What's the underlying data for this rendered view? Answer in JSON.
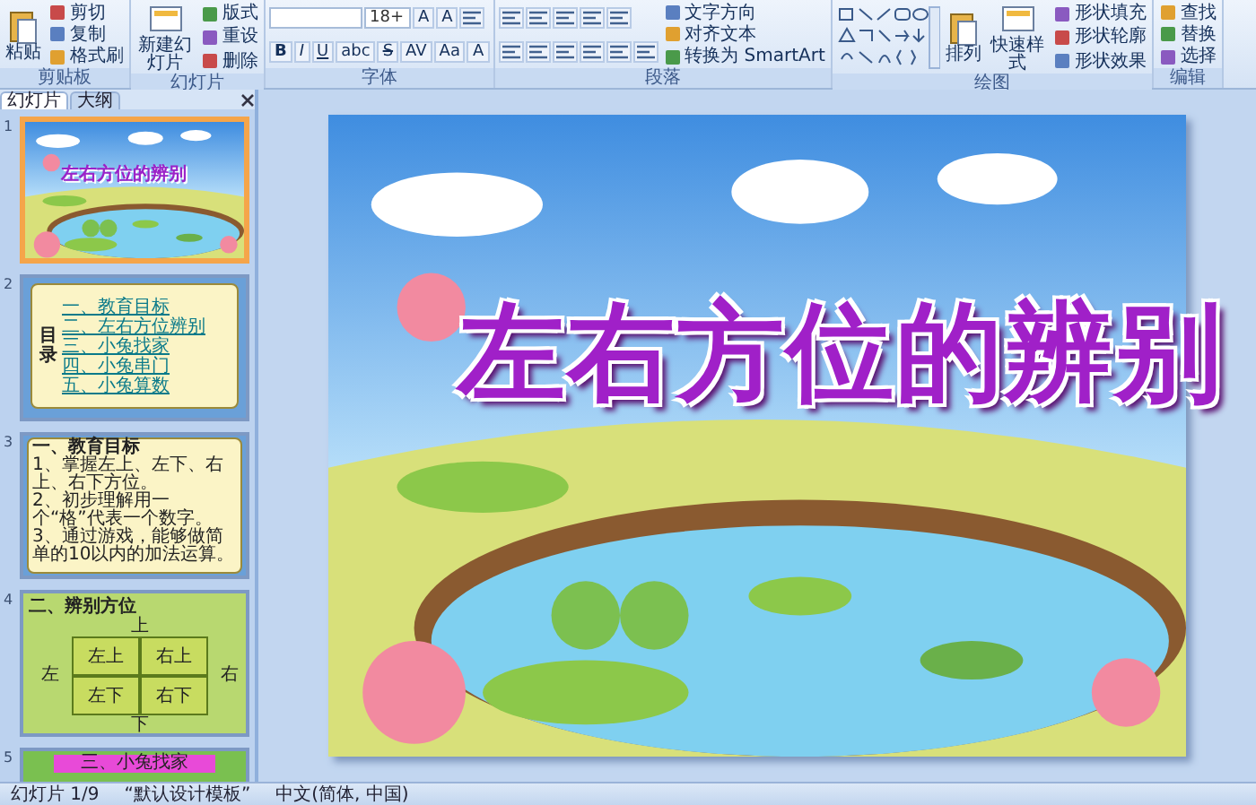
{
  "ribbon": {
    "groups": [
      {
        "label": "剪贴板",
        "columns": [
          {
            "items": [
              {
                "kind": "large",
                "label": "粘贴"
              }
            ]
          },
          {
            "items": [
              {
                "kind": "small",
                "label": "剪切"
              },
              {
                "kind": "small",
                "label": "复制"
              },
              {
                "kind": "small",
                "label": "格式刷"
              }
            ]
          }
        ]
      },
      {
        "label": "幻灯片",
        "columns": [
          {
            "items": [
              {
                "kind": "large",
                "label": "新建幻灯片"
              }
            ]
          },
          {
            "items": [
              {
                "kind": "small",
                "label": "版式"
              },
              {
                "kind": "small",
                "label": "重设"
              },
              {
                "kind": "small",
                "label": "删除"
              }
            ]
          }
        ]
      },
      {
        "label": "字体",
        "columns": [
          {
            "items": [
              {
                "kind": "strip",
                "items": [
                  {
                    "kind": "field",
                    "wide": true
                  },
                  {
                    "kind": "field",
                    "value": "18+"
                  },
                  {
                    "kind": "glyph",
                    "label": "A"
                  },
                  {
                    "kind": "glyph",
                    "label": "A"
                  },
                  {
                    "kind": "icon"
                  }
                ]
              },
              {
                "kind": "strip",
                "items": [
                  {
                    "kind": "glyph",
                    "label": "B"
                  },
                  {
                    "kind": "glyph",
                    "label": "I"
                  },
                  {
                    "kind": "glyph",
                    "label": "U"
                  },
                  {
                    "kind": "glyph",
                    "label": "abc"
                  },
                  {
                    "kind": "glyph",
                    "label": "S"
                  },
                  {
                    "kind": "glyph",
                    "label": "AV"
                  },
                  {
                    "kind": "glyph",
                    "label": "Aa"
                  },
                  {
                    "kind": "glyph",
                    "label": "A"
                  }
                ]
              }
            ]
          }
        ]
      },
      {
        "label": "段落",
        "columns": [
          {
            "items": [
              {
                "kind": "strip",
                "items": [
                  {
                    "kind": "icon"
                  },
                  {
                    "kind": "icon"
                  },
                  {
                    "kind": "icon"
                  },
                  {
                    "kind": "icon"
                  },
                  {
                    "kind": "icon"
                  }
                ]
              },
              {
                "kind": "strip",
                "items": [
                  {
                    "kind": "icon"
                  },
                  {
                    "kind": "icon"
                  },
                  {
                    "kind": "icon"
                  },
                  {
                    "kind": "icon"
                  },
                  {
                    "kind": "icon"
                  },
                  {
                    "kind": "icon"
                  }
                ]
              }
            ]
          },
          {
            "items": [
              {
                "kind": "small",
                "label": "文字方向"
              },
              {
                "kind": "small",
                "label": "对齐文本"
              },
              {
                "kind": "small",
                "label": "转换为 SmartArt"
              }
            ]
          }
        ]
      },
      {
        "label": "绘图",
        "columns": [
          {
            "items": [
              {
                "kind": "gallery"
              }
            ]
          },
          {
            "items": [
              {
                "kind": "large",
                "label": "排列"
              }
            ]
          },
          {
            "items": [
              {
                "kind": "large",
                "label": "快速样式"
              }
            ]
          },
          {
            "items": [
              {
                "kind": "small",
                "label": "形状填充"
              },
              {
                "kind": "small",
                "label": "形状轮廓"
              },
              {
                "kind": "small",
                "label": "形状效果"
              }
            ]
          }
        ]
      },
      {
        "label": "编辑",
        "columns": [
          {
            "items": [
              {
                "kind": "small",
                "label": "查找"
              },
              {
                "kind": "small",
                "label": "替换"
              },
              {
                "kind": "small",
                "label": "选择"
              }
            ]
          }
        ]
      }
    ]
  },
  "panel": {
    "tabs": [
      {
        "label": "幻灯片",
        "selected": true
      },
      {
        "label": "大纲",
        "selected": false
      }
    ],
    "slides": [
      {
        "number": "1",
        "kind": "title",
        "selected": true,
        "title": "左右方位的辨别"
      },
      {
        "number": "2",
        "kind": "contents",
        "selected": false,
        "heading": "目录",
        "items": [
          "一、教育目标",
          "二、左右方位辨别",
          "三、小兔找家",
          "四、小兔串门",
          "五、小兔算数"
        ]
      },
      {
        "number": "3",
        "kind": "objectives",
        "selected": false,
        "heading": "一、教育目标",
        "items": [
          "1、掌握左上、左下、右上、右下方位。",
          "2、初步理解用一个“格”代表一个数字。",
          "3、通过游戏，能够做简单的10以内的加法运算。"
        ]
      },
      {
        "number": "4",
        "kind": "grid",
        "selected": false,
        "heading": "二、辨别方位",
        "top": "上",
        "left": "左",
        "right": "右",
        "bottom": "下",
        "cells": [
          "左上",
          "右上",
          "左下",
          "右下"
        ]
      },
      {
        "number": "5",
        "kind": "partial",
        "selected": false,
        "heading": "三、小兔找家"
      }
    ]
  },
  "slide": {
    "title": "左右方位的辨别"
  },
  "status_bar": {
    "slide_counter": "幻灯片 1/9",
    "theme": "“默认设计模板”",
    "language": "中文(简体, 中国)"
  }
}
